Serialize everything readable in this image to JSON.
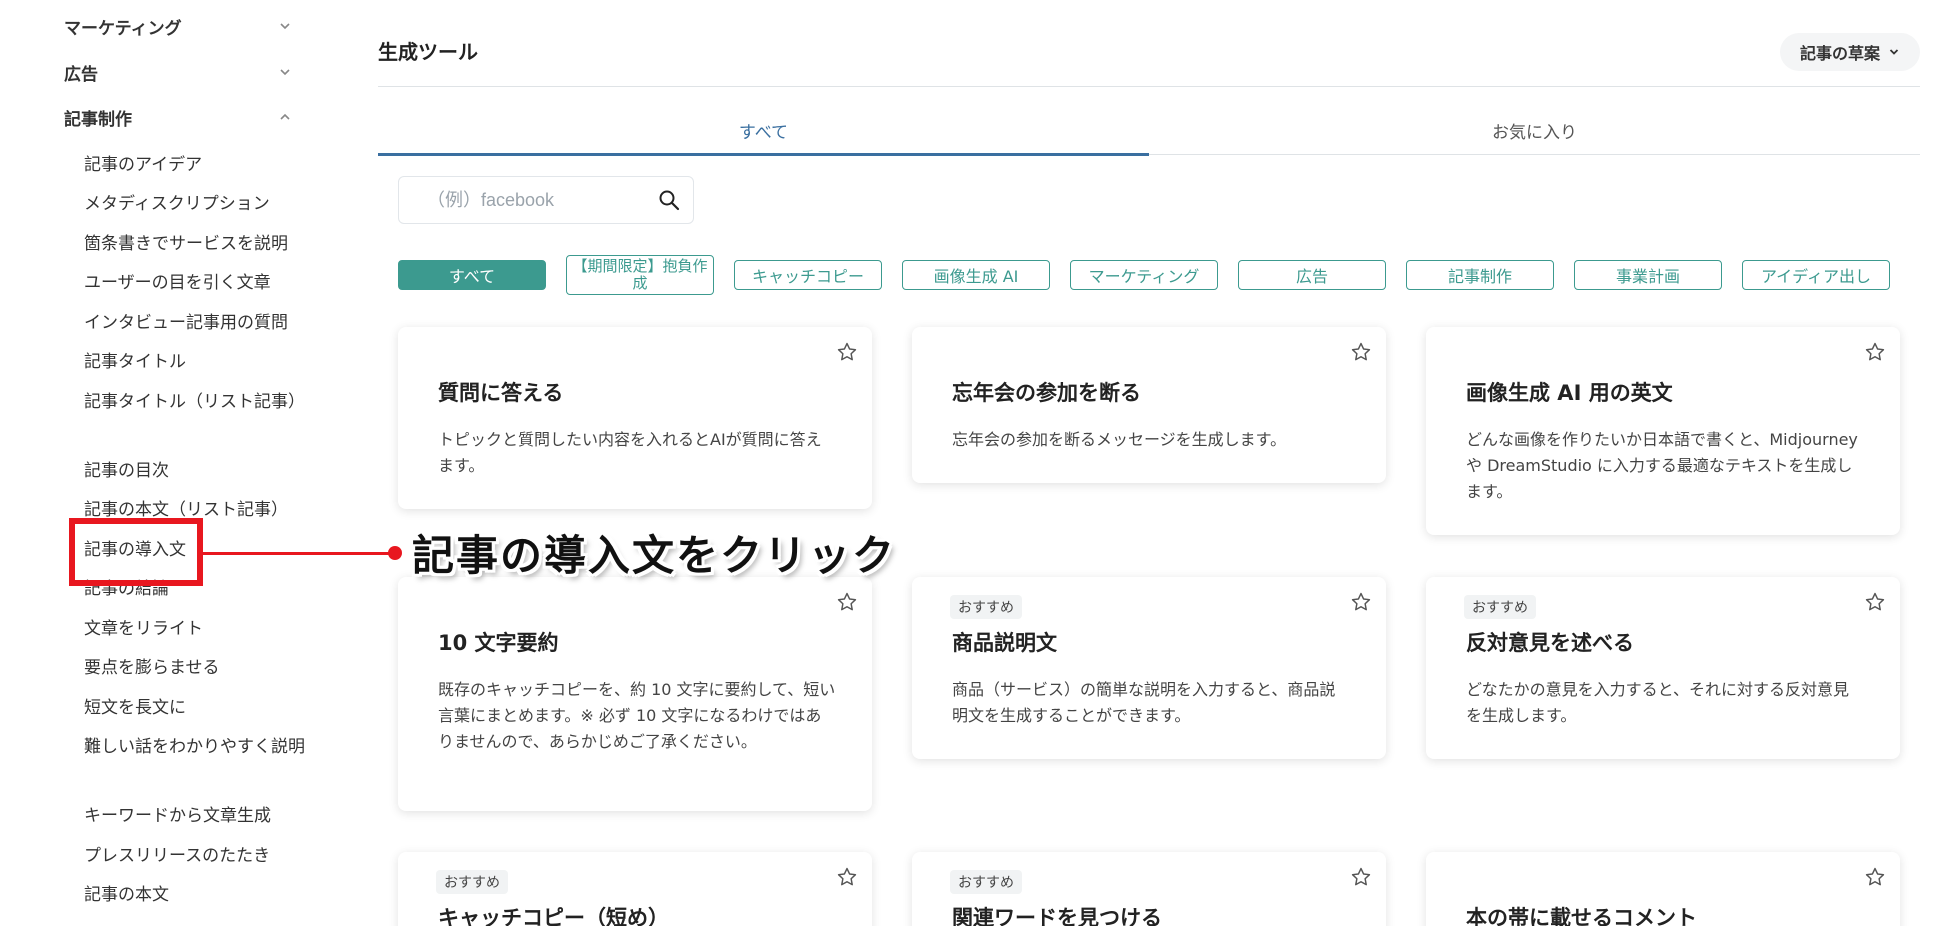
{
  "sidebar": {
    "categories": [
      {
        "label": "マーケティング",
        "expanded": false
      },
      {
        "label": "広告",
        "expanded": false
      },
      {
        "label": "記事制作",
        "expanded": true
      }
    ],
    "items": [
      "記事のアイデア",
      "メタディスクリプション",
      "箇条書きでサービスを説明",
      "ユーザーの目を引く文章",
      "インタビュー記事用の質問",
      "記事タイトル",
      "記事タイトル（リスト記事）",
      "記事の目次",
      "記事の本文（リスト記事）",
      "記事の導入文",
      "記事の結論",
      "文章をリライト",
      "要点を膨らませる",
      "短文を長文に",
      "難しい話をわかりやすく説明",
      "キーワードから文章生成",
      "プレスリリースのたたき",
      "記事の本文"
    ]
  },
  "header": {
    "title": "生成ツール",
    "draft_label": "記事の草案"
  },
  "tabs": [
    {
      "label": "すべて",
      "active": true
    },
    {
      "label": "お気に入り",
      "active": false
    }
  ],
  "search": {
    "placeholder": "（例）facebook"
  },
  "chips": [
    "すべて",
    "【期間限定】抱負作成",
    "キャッチコピー",
    "画像生成 AI",
    "マーケティング",
    "広告",
    "記事制作",
    "事業計画",
    "アイディア出し"
  ],
  "cards": [
    {
      "title": "質問に答える",
      "desc": "トピックと質問したい内容を入れるとAIが質問に答えます。",
      "badge": ""
    },
    {
      "title": "忘年会の参加を断る",
      "desc": "忘年会の参加を断るメッセージを生成します。",
      "badge": ""
    },
    {
      "title": "画像生成 AI 用の英文",
      "desc": "どんな画像を作りたいか日本語で書くと、Midjourney や DreamStudio に入力する最適なテキストを生成します。",
      "badge": ""
    },
    {
      "title": "10 文字要約",
      "desc": "既存のキャッチコピーを、約 10 文字に要約して、短い言葉にまとめます。※ 必ず 10 文字になるわけではありませんので、あらかじめご了承ください。",
      "badge": ""
    },
    {
      "title": "商品説明文",
      "desc": "商品（サービス）の簡単な説明を入力すると、商品説明文を生成することができます。",
      "badge": "おすすめ"
    },
    {
      "title": "反対意見を述べる",
      "desc": "どなたかの意見を入力すると、それに対する反対意見を生成します。",
      "badge": "おすすめ"
    },
    {
      "title": "キャッチコピー（短め）",
      "desc": "",
      "badge": "おすすめ"
    },
    {
      "title": "関連ワードを見つける",
      "desc": "",
      "badge": "おすすめ"
    },
    {
      "title": "本の帯に載せるコメント",
      "desc": "",
      "badge": ""
    }
  ],
  "annotation": {
    "text": "記事の導入文をクリック",
    "color": "#e8171f"
  },
  "colors": {
    "accent": "#3c9a8f",
    "tab_active": "#3a6fa0"
  }
}
